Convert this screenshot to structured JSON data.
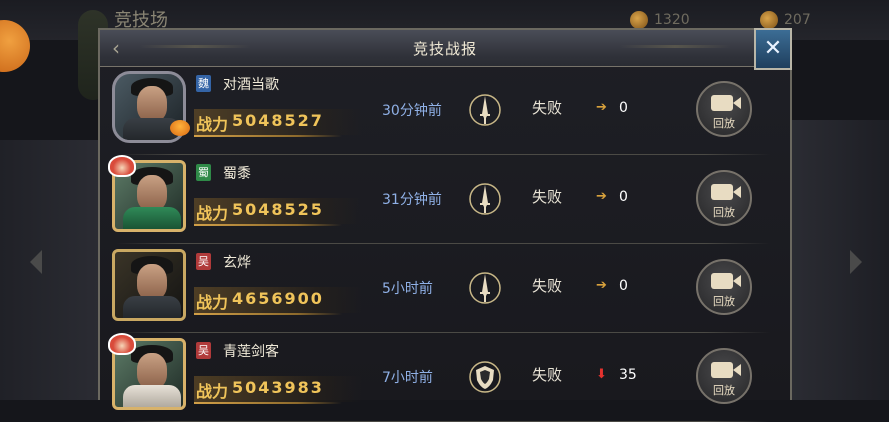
{
  "background": {
    "title": "竞技场",
    "currency_1": "1320",
    "currency_2": "207",
    "badge": ""
  },
  "dialog": {
    "title": "竞技战报",
    "close_label": "✕"
  },
  "rows": [
    {
      "faction": "魏",
      "faction_color": "#3464a6",
      "name": "对酒当歌",
      "power_label": "战力",
      "power": "5048527",
      "time": "30分钟前",
      "result": "失败",
      "delta_direction": "up",
      "delta": "0",
      "replay_label": "回放"
    },
    {
      "faction": "蜀",
      "faction_color": "#2f8a48",
      "name": "蜀黍",
      "power_label": "战力",
      "power": "5048525",
      "time": "31分钟前",
      "result": "失败",
      "delta_direction": "up",
      "delta": "0",
      "replay_label": "回放"
    },
    {
      "faction": "吴",
      "faction_color": "#b03a3a",
      "name": "玄烨",
      "power_label": "战力",
      "power": "4656900",
      "time": "5小时前",
      "result": "失败",
      "delta_direction": "up",
      "delta": "0",
      "replay_label": "回放"
    },
    {
      "faction": "吴",
      "faction_color": "#b03a3a",
      "name": "青莲剑客",
      "power_label": "战力",
      "power": "5043983",
      "time": "7小时前",
      "result": "失败",
      "delta_direction": "down",
      "delta": "35",
      "replay_label": "回放"
    }
  ],
  "icons": {
    "back": "chevron-left-icon",
    "close": "close-icon",
    "sword": "sword-icon",
    "shield": "shield-icon",
    "arrow_up": "arrow-right-icon",
    "arrow_down": "arrow-down-icon",
    "camera": "video-camera-icon"
  },
  "colors": {
    "accent_gold": "#f0c45a",
    "time_blue": "#8fb0e6",
    "loss_red": "#e4322e"
  }
}
